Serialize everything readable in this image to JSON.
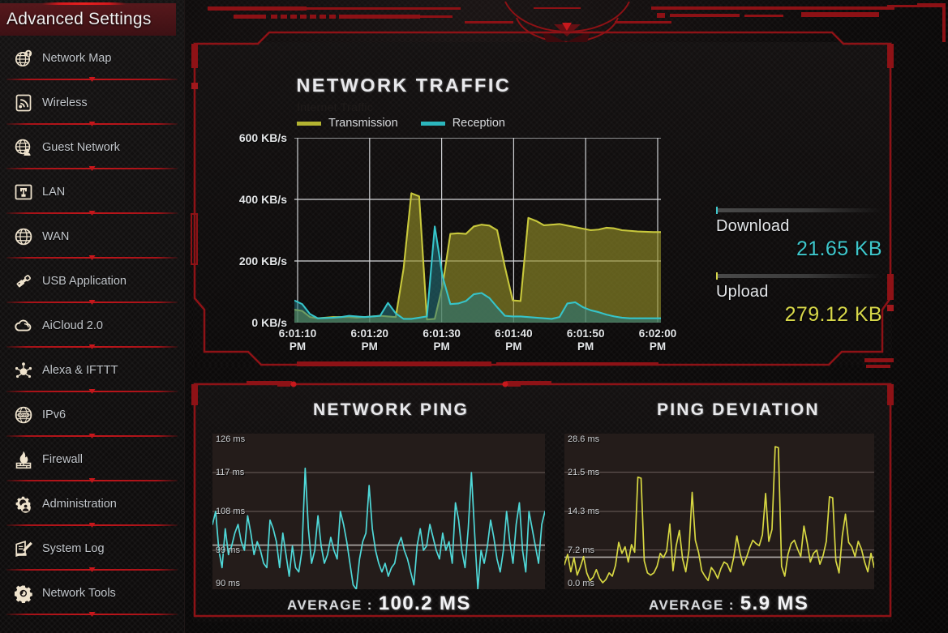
{
  "sidebar": {
    "header": "Advanced Settings",
    "items": [
      {
        "label": "Network Map",
        "icon": "network-map-icon"
      },
      {
        "label": "Wireless",
        "icon": "wireless-icon"
      },
      {
        "label": "Guest Network",
        "icon": "guest-network-icon"
      },
      {
        "label": "LAN",
        "icon": "lan-icon"
      },
      {
        "label": "WAN",
        "icon": "wan-globe-icon"
      },
      {
        "label": "USB Application",
        "icon": "usb-icon"
      },
      {
        "label": "AiCloud 2.0",
        "icon": "cloud-icon"
      },
      {
        "label": "Alexa & IFTTT",
        "icon": "alexa-ifttt-icon"
      },
      {
        "label": "IPv6",
        "icon": "ipv6-icon"
      },
      {
        "label": "Firewall",
        "icon": "firewall-flame-icon"
      },
      {
        "label": "Administration",
        "icon": "gear-person-icon"
      },
      {
        "label": "System Log",
        "icon": "system-log-icon"
      },
      {
        "label": "Network Tools",
        "icon": "network-tools-gear-icon"
      }
    ]
  },
  "traffic_panel": {
    "title": "NETWORK TRAFFIC",
    "subtitle": "Internet Traffic",
    "legend": [
      {
        "label": "Transmission",
        "color": "#b4b431"
      },
      {
        "label": "Reception",
        "color": "#2cb6bd"
      }
    ],
    "stats": {
      "download_label": "Download",
      "download_value": "21.65 KB",
      "download_color": "#3ec7cc",
      "upload_label": "Upload",
      "upload_value": "279.12 KB",
      "upload_color": "#d8d84a"
    }
  },
  "ping_panel": {
    "title": "NETWORK PING",
    "average_label": "AVERAGE :",
    "average_value": "100.2 MS"
  },
  "deviation_panel": {
    "title": "PING DEVIATION",
    "average_label": "AVERAGE :",
    "average_value": "5.9 MS"
  },
  "chart_data": [
    {
      "type": "area",
      "id": "network-traffic",
      "title": "NETWORK TRAFFIC",
      "subtitle": "Internet Traffic",
      "xlabel": "",
      "ylabel": "KB/s",
      "ylim": [
        0,
        600
      ],
      "ytick_labels": [
        "0 KB/s",
        "200 KB/s",
        "400 KB/s",
        "600 KB/s"
      ],
      "yticks": [
        0,
        200,
        400,
        600
      ],
      "xtick_labels": [
        "6:01:10 PM",
        "6:01:20 PM",
        "6:01:30 PM",
        "6:01:40 PM",
        "6:01:50 PM",
        "6:02:00 PM"
      ],
      "grid": true,
      "legend_position": "top-left",
      "series": [
        {
          "name": "Transmission",
          "color": "#c8c83c",
          "fill": "rgba(150,146,40,0.62)",
          "values": [
            42,
            38,
            18,
            14,
            16,
            18,
            18,
            18,
            16,
            18,
            20,
            22,
            20,
            18,
            175,
            420,
            410,
            10,
            12,
            120,
            288,
            290,
            288,
            312,
            318,
            315,
            300,
            180,
            72,
            70,
            340,
            330,
            316,
            318,
            320,
            315,
            310,
            305,
            300,
            302,
            308,
            306,
            300,
            298,
            296,
            295,
            294,
            294
          ]
        },
        {
          "name": "Reception",
          "color": "#36c4c9",
          "fill": "rgba(36,120,130,0.55)",
          "values": [
            72,
            60,
            28,
            14,
            15,
            16,
            18,
            22,
            20,
            18,
            20,
            22,
            64,
            30,
            12,
            12,
            16,
            20,
            312,
            150,
            60,
            62,
            70,
            92,
            96,
            80,
            50,
            22,
            20,
            20,
            18,
            16,
            14,
            12,
            18,
            62,
            66,
            50,
            40,
            34,
            26,
            20,
            16,
            14,
            14,
            14,
            14,
            14
          ]
        }
      ]
    },
    {
      "type": "line",
      "id": "network-ping",
      "title": "NETWORK PING",
      "xlabel": "",
      "ylabel": "ms",
      "ylim": [
        90,
        126
      ],
      "ytick_labels": [
        "126 ms",
        "117 ms",
        "108 ms",
        "99 ms",
        "90 ms"
      ],
      "yticks": [
        126,
        117,
        108,
        99,
        90
      ],
      "grid": true,
      "average": 100.2,
      "average_label": "AVERAGE : 100.2 MS",
      "series": [
        {
          "name": "Ping",
          "color": "#4fd8d8",
          "values": [
            105,
            108,
            99,
            95,
            104,
            98,
            100,
            103,
            105,
            101,
            99,
            107,
            103,
            98,
            101,
            99,
            96,
            95,
            106,
            104,
            101,
            95,
            103,
            98,
            93,
            100,
            95,
            94,
            99,
            118,
            104,
            96,
            99,
            107,
            100,
            96,
            98,
            102,
            99,
            97,
            108,
            105,
            101,
            96,
            91,
            90,
            97,
            101,
            103,
            114,
            104,
            99,
            96,
            94,
            96,
            93,
            95,
            96,
            100,
            102,
            99,
            97,
            94,
            91,
            100,
            104,
            99,
            100,
            105,
            102,
            99,
            97,
            103,
            99,
            101,
            96,
            110,
            106,
            99,
            95,
            104,
            117,
            103,
            90,
            99,
            96,
            100,
            106,
            102,
            97,
            94,
            99,
            108,
            101,
            96,
            105,
            110,
            99,
            94,
            108,
            104,
            100,
            96,
            105,
            108
          ]
        }
      ]
    },
    {
      "type": "line",
      "id": "ping-deviation",
      "title": "PING DEVIATION",
      "xlabel": "",
      "ylabel": "ms",
      "ylim": [
        0,
        28.6
      ],
      "ytick_labels": [
        "28.6 ms",
        "21.5 ms",
        "14.3 ms",
        "7.2 ms",
        "0.0 ms"
      ],
      "yticks": [
        28.6,
        21.5,
        14.3,
        7.2,
        0.0
      ],
      "grid": true,
      "average": 5.9,
      "average_label": "AVERAGE : 5.9 MS",
      "series": [
        {
          "name": "Deviation",
          "color": "#d7d742",
          "values": [
            4.5,
            6.4,
            3.2,
            5.8,
            2.6,
            4.1,
            6.0,
            3.0,
            1.6,
            2.2,
            3.6,
            2.0,
            1.2,
            1.8,
            3.0,
            2.4,
            4.4,
            8.6,
            6.6,
            7.8,
            5.0,
            8.2,
            6.8,
            20.6,
            20.4,
            5.2,
            3.0,
            2.6,
            3.0,
            4.2,
            6.6,
            5.8,
            7.0,
            12.0,
            3.4,
            8.0,
            10.8,
            5.6,
            3.2,
            7.2,
            17.8,
            9.0,
            6.8,
            3.4,
            2.4,
            1.6,
            4.0,
            3.2,
            2.0,
            3.8,
            5.0,
            4.6,
            3.2,
            5.8,
            9.8,
            6.6,
            4.4,
            5.8,
            7.6,
            9.0,
            8.4,
            8.0,
            10.0,
            17.6,
            8.8,
            11.0,
            26.2,
            26.0,
            4.2,
            2.4,
            6.4,
            8.4,
            9.0,
            7.4,
            6.0,
            11.6,
            8.6,
            5.0,
            6.6,
            7.2,
            4.6,
            6.2,
            8.8,
            17.0,
            16.8,
            5.2,
            3.0,
            9.8,
            13.8,
            8.6,
            7.8,
            6.0,
            8.8,
            7.4,
            5.0,
            3.2,
            6.6,
            4.0
          ]
        }
      ]
    }
  ]
}
